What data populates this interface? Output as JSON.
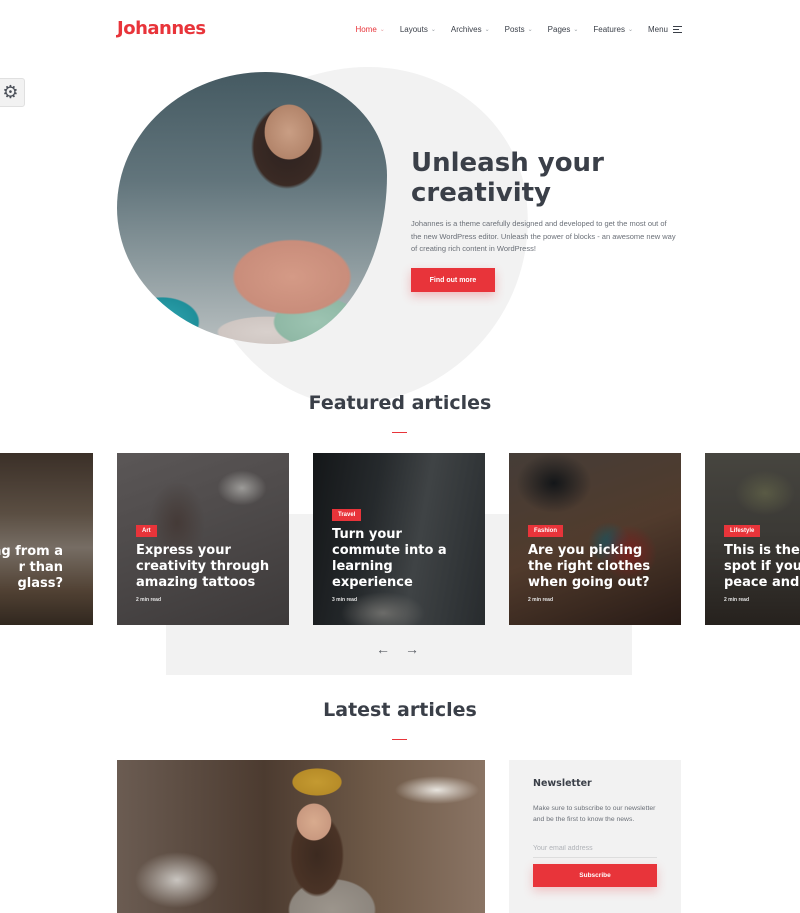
{
  "header": {
    "logo": "Johannes",
    "nav": [
      {
        "label": "Home",
        "has_dropdown": true,
        "active": true
      },
      {
        "label": "Layouts",
        "has_dropdown": true,
        "active": false
      },
      {
        "label": "Archives",
        "has_dropdown": true,
        "active": false
      },
      {
        "label": "Posts",
        "has_dropdown": true,
        "active": false
      },
      {
        "label": "Pages",
        "has_dropdown": true,
        "active": false
      },
      {
        "label": "Features",
        "has_dropdown": true,
        "active": false
      }
    ],
    "menu_label": "Menu",
    "chevron_glyph": "⌄"
  },
  "settings": {
    "icon": "gear-icon",
    "glyph": "⚙"
  },
  "hero": {
    "title_line1": "Unleash your",
    "title_line2": "creativity",
    "text": "Johannes is a theme carefully designed and developed to get the most out of the new WordPress editor. Unleash the power of blocks - an awesome new way of creating rich content in WordPress!",
    "button": "Find out more"
  },
  "featured": {
    "title": "Featured articles",
    "cards": [
      {
        "category": "",
        "title_lines": [
          "ng from a",
          "r than",
          "glass?"
        ],
        "read_time": ""
      },
      {
        "category": "Art",
        "title_lines": [
          "Express your",
          "creativity through",
          "amazing tattoos"
        ],
        "read_time": "2 min read"
      },
      {
        "category": "Travel",
        "title_lines": [
          "Turn your",
          "commute into a",
          "learning",
          "experience"
        ],
        "read_time": "3 min read"
      },
      {
        "category": "Fashion",
        "title_lines": [
          "Are you picking",
          "the right clothes",
          "when going out?"
        ],
        "read_time": "2 min read"
      },
      {
        "category": "Lifestyle",
        "title_lines": [
          "This is the p",
          "spot if you",
          "peace and"
        ],
        "read_time": "2 min read"
      }
    ],
    "prev_glyph": "←",
    "next_glyph": "→"
  },
  "latest": {
    "title": "Latest articles"
  },
  "newsletter": {
    "title": "Newsletter",
    "text": "Make sure to subscribe to our newsletter and be the first to know the news.",
    "placeholder": "Your email address",
    "value": "",
    "button": "Subscribe"
  },
  "colors": {
    "accent": "#e8343a",
    "text_dark": "#3a3f48",
    "panel_bg": "#f2f2f2"
  }
}
